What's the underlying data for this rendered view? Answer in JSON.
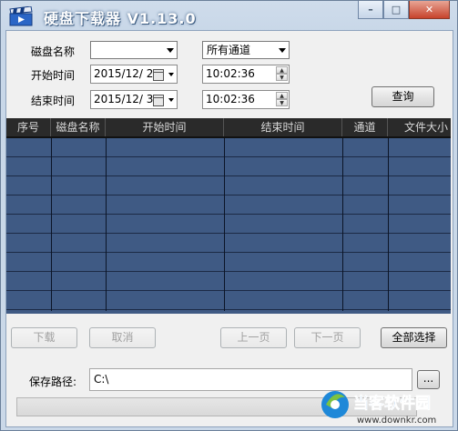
{
  "window": {
    "title": "硬盘下载器 V1.13.0",
    "min_glyph": "–",
    "max_glyph": "□",
    "close_glyph": "✕"
  },
  "form": {
    "disk_name_label": "磁盘名称",
    "disk_name_value": "",
    "channel_value": "所有通道",
    "start_time_label": "开始时间",
    "start_date": "2015/12/ 2",
    "start_time": "10:02:36",
    "end_time_label": "结束时间",
    "end_date": "2015/12/ 3",
    "end_time": "10:02:36",
    "query_button": "查询"
  },
  "table": {
    "columns": [
      "序号",
      "磁盘名称",
      "开始时间",
      "结束时间",
      "通道",
      "文件大小"
    ],
    "visible_empty_rows": 9
  },
  "actions": {
    "download": "下载",
    "cancel": "取消",
    "prev_page": "上一页",
    "next_page": "下一页",
    "select_all": "全部选择"
  },
  "save": {
    "label": "保存路径:",
    "path": "C:\\",
    "browse": "..."
  },
  "watermark": {
    "brand": "当客软件园",
    "url": "www.downkr.com"
  },
  "colors": {
    "grid_row": "#3f5a84",
    "grid_header": "#2a2a2a",
    "title_text": "#ffffff"
  }
}
